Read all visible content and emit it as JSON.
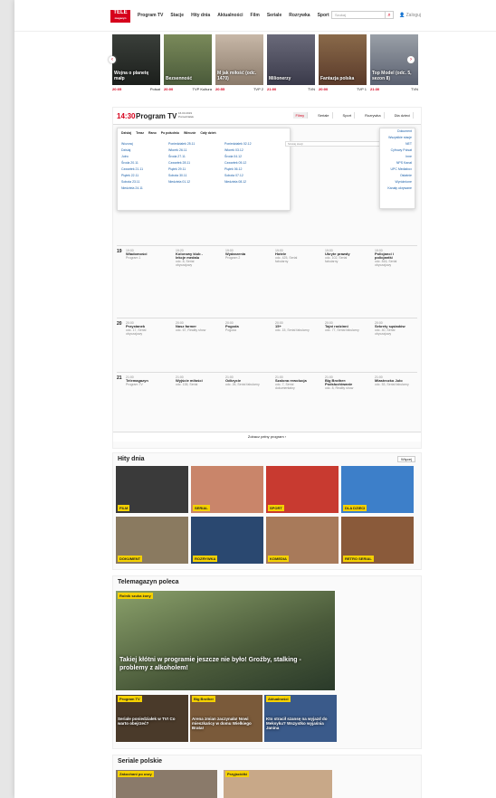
{
  "header": {
    "logo_line1": "TELE",
    "logo_line2": "magazyn",
    "nav": [
      "Program TV",
      "Stacje",
      "Hity dnia",
      "Aktualności",
      "Film",
      "Seriale",
      "Rozrywka",
      "Sport"
    ],
    "search_placeholder": "Szukaj",
    "login": "Zaloguj"
  },
  "top_strip": [
    {
      "title": "Wojna o planetę małp",
      "time": "20:05",
      "channel": "Polsat"
    },
    {
      "title": "Bezsenność",
      "time": "20:00",
      "channel": "TVP Kultura"
    },
    {
      "title": "M jak miłość (odc. 1470)",
      "time": "20:55",
      "channel": "TVP 2"
    },
    {
      "title": "Milionerzy",
      "time": "21:00",
      "channel": "TVN"
    },
    {
      "title": "Fantazja polska",
      "time": "20:00",
      "channel": "TVP 1"
    },
    {
      "title": "Top Model (odc. 5, sezon 8)",
      "time": "21:30",
      "channel": "TVN"
    }
  ],
  "program": {
    "time": "14:30",
    "title": "Program TV",
    "date_line1": "16.03.2019",
    "date_line2": "Poniedziałek",
    "cats": [
      "Filmy",
      "Seriale",
      "Sport",
      "Rozrywka",
      "Dla dzieci"
    ],
    "active_cat": "Filmy",
    "dropdown_tabs": [
      "Dzisiaj",
      "Teraz",
      "Rano",
      "Po południu",
      "Wieczór",
      "Cały dzień"
    ],
    "days": [
      "Wczoraj",
      "Dzisiaj",
      "Jutro",
      "Środa 20.11",
      "Czwartek 21.11",
      "Piątek 22.11",
      "Sobota 23.11",
      "Niedziela 24.11"
    ],
    "days2": [
      "Poniedziałek 25.11",
      "Wtorek 26.11",
      "Środa 27.11",
      "Czwartek 28.11",
      "Piątek 29.11",
      "Sobota 30.11",
      "Niedziela 01.12"
    ],
    "days3": [
      "Poniedziałek 02.12",
      "Wtorek 03.12",
      "Środa 04.12",
      "Czwartek 05.12",
      "Piątek 06.12",
      "Sobota 07.12",
      "Niedziela 08.12"
    ],
    "all_stations": "Wszystkie stacje",
    "channels": [
      "Dokument",
      "Wszystkie stacje",
      "NET",
      "Cyfrowy Polsat",
      "Inne",
      "NPS Kanał",
      "UPC Mediabox",
      "Ostatnie",
      "Wyróżnione",
      "Kanały ukrywane"
    ],
    "search_channel": "Szukaj stacji",
    "pager": "Zobacz pełny program ›",
    "hours": [
      "19",
      "20",
      "21"
    ],
    "rows": [
      [
        {
          "t": "19:00",
          "n": "Wiadomości",
          "c": "Program 1"
        },
        {
          "t": "19:20",
          "n": "Kolorowy klub - lekcje medalu",
          "c": "odc. 8, Serial obyczajowy"
        },
        {
          "t": "19:00",
          "n": "Wydarzenia",
          "c": "Program 2"
        },
        {
          "t": "19:00",
          "n": "Hotele",
          "c": "odc. 425, Serial fabularny"
        },
        {
          "t": "19:00",
          "n": "Ukryte prawdy",
          "c": "odc. 102, Serial fabularny"
        },
        {
          "t": "19:00",
          "n": "Policjanci i policjantki",
          "c": "odc. 816, Serial obyczajowy"
        }
      ],
      [
        {
          "t": "20:00",
          "n": "Przystanek",
          "c": "odc. 17, Serial obyczajowy"
        },
        {
          "t": "20:00",
          "n": "Nasz farmer",
          "c": "odc. 67, Reality show"
        },
        {
          "t": "20:00",
          "n": "Pogoda",
          "c": "Pogoda"
        },
        {
          "t": "20:00",
          "n": "15+",
          "c": "odc. 15, Serial fabularny"
        },
        {
          "t": "20:00",
          "n": "Tajni rodzinni",
          "c": "odc. 77, Serial fabularny"
        },
        {
          "t": "20:00",
          "n": "Sekrety sąsiadów",
          "c": "odc. 40, Serial obyczajowy"
        }
      ],
      [
        {
          "t": "21:00",
          "n": "Telemagazyn",
          "c": "Program TV"
        },
        {
          "t": "21:00",
          "n": "Wyjście miłości",
          "c": "odc. 138, Serial"
        },
        {
          "t": "21:00",
          "n": "Odkrycie",
          "c": "odc. 26, Serial fabularny"
        },
        {
          "t": "21:00",
          "n": "Szalona rewolucja",
          "c": "odc. 7, Serial dokumentalny"
        },
        {
          "t": "21:00",
          "n": "Big Brother: Podsłuchiwanie",
          "c": "odc. 8, Reality show"
        },
        {
          "t": "21:00",
          "n": "Miasteczko Julo",
          "c": "odc. 53, Serial fabularny"
        }
      ]
    ]
  },
  "hits": {
    "title": "Hity dnia",
    "more": "Więcej",
    "tiles": [
      "FILM",
      "SERIAL",
      "SPORT",
      "DLA DZIECI",
      "DOKUMENT",
      "ROZRYWKA",
      "KOMEDIA",
      "RETRO SERIAL"
    ],
    "colors": [
      "#3a3a3a",
      "#c9856a",
      "#c83a30",
      "#3d7fc9",
      "#8a7a60",
      "#2a4870",
      "#a87a5a",
      "#8a5a3a"
    ]
  },
  "feature": {
    "title": "Telemagazyn poleca",
    "badge": "Rolnik szuka żony",
    "headline": "Takiej kłótni w programie jeszcze nie było! Groźby, stalking - problemy z alkoholem!",
    "small": [
      {
        "badge": "Program TV",
        "text": "Seriale poniedziałek w TV! Co warto obejrzeć?"
      },
      {
        "badge": "Big Brother",
        "text": "Arena zmian zaczynała! Nowi mieszkańcy w domu Wielkiego Brata!"
      },
      {
        "badge": "Aktualności",
        "text": "Kto stracił szansę na wyjazd do Meksyku? Wszystko wyjaśnia Janina"
      }
    ]
  },
  "serials": {
    "title": "Seriale polskie",
    "badge1": "Zakochani po uszy",
    "badge2": "Przyjaciółki"
  }
}
